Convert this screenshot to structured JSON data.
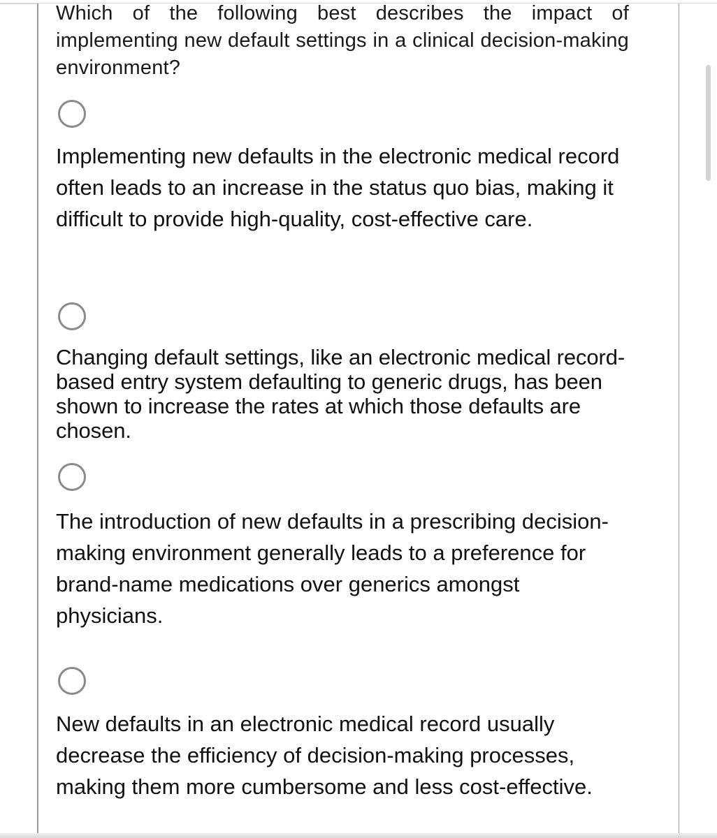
{
  "question": {
    "text": "Which of the following best describes the impact of implementing new default settings in a clinical decision-making environment?"
  },
  "options": [
    {
      "id": "a",
      "selected": false,
      "text": "Implementing new defaults in the electronic medical record often leads to an increase in the status quo bias, making it difficult to provide high-quality, cost-effective care."
    },
    {
      "id": "b",
      "selected": false,
      "text": "Changing default settings, like an electronic medical record-based entry system defaulting to generic drugs, has been shown to increase the rates at which those defaults are chosen."
    },
    {
      "id": "c",
      "selected": false,
      "text": "The introduction of new defaults in a prescribing decision-making environment generally leads to a preference for brand-name medications over generics amongst physicians."
    },
    {
      "id": "d",
      "selected": false,
      "text": "New defaults in an electronic medical record usually decrease the efficiency of decision-making processes, making them more cumbersome and less cost-effective."
    }
  ],
  "icons": {
    "radio": "radio-unchecked-icon"
  }
}
